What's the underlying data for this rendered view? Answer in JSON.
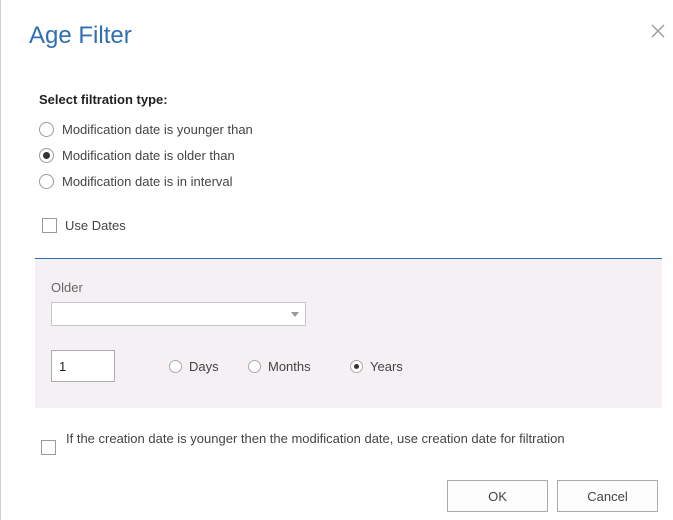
{
  "dialog": {
    "title": "Age Filter",
    "close_icon": "close-icon"
  },
  "filtration": {
    "label": "Select filtration type:",
    "options": [
      {
        "label": "Modification date is younger than",
        "checked": false
      },
      {
        "label": "Modification date is older than",
        "checked": true
      },
      {
        "label": "Modification date is in interval",
        "checked": false
      }
    ]
  },
  "use_dates": {
    "label": "Use Dates",
    "checked": false
  },
  "panel": {
    "label": "Older",
    "dropdown_value": "",
    "number_value": "1",
    "units": [
      {
        "label": "Days",
        "checked": false
      },
      {
        "label": "Months",
        "checked": false
      },
      {
        "label": "Years",
        "checked": true
      }
    ]
  },
  "creation_date_option": {
    "label": "If the creation date is younger then the modification date, use creation date for filtration",
    "checked": false
  },
  "buttons": {
    "ok": "OK",
    "cancel": "Cancel"
  },
  "colors": {
    "title": "#2f6fb5",
    "separator": "#2f6fb5",
    "panel_background": "#f4f0f3"
  }
}
